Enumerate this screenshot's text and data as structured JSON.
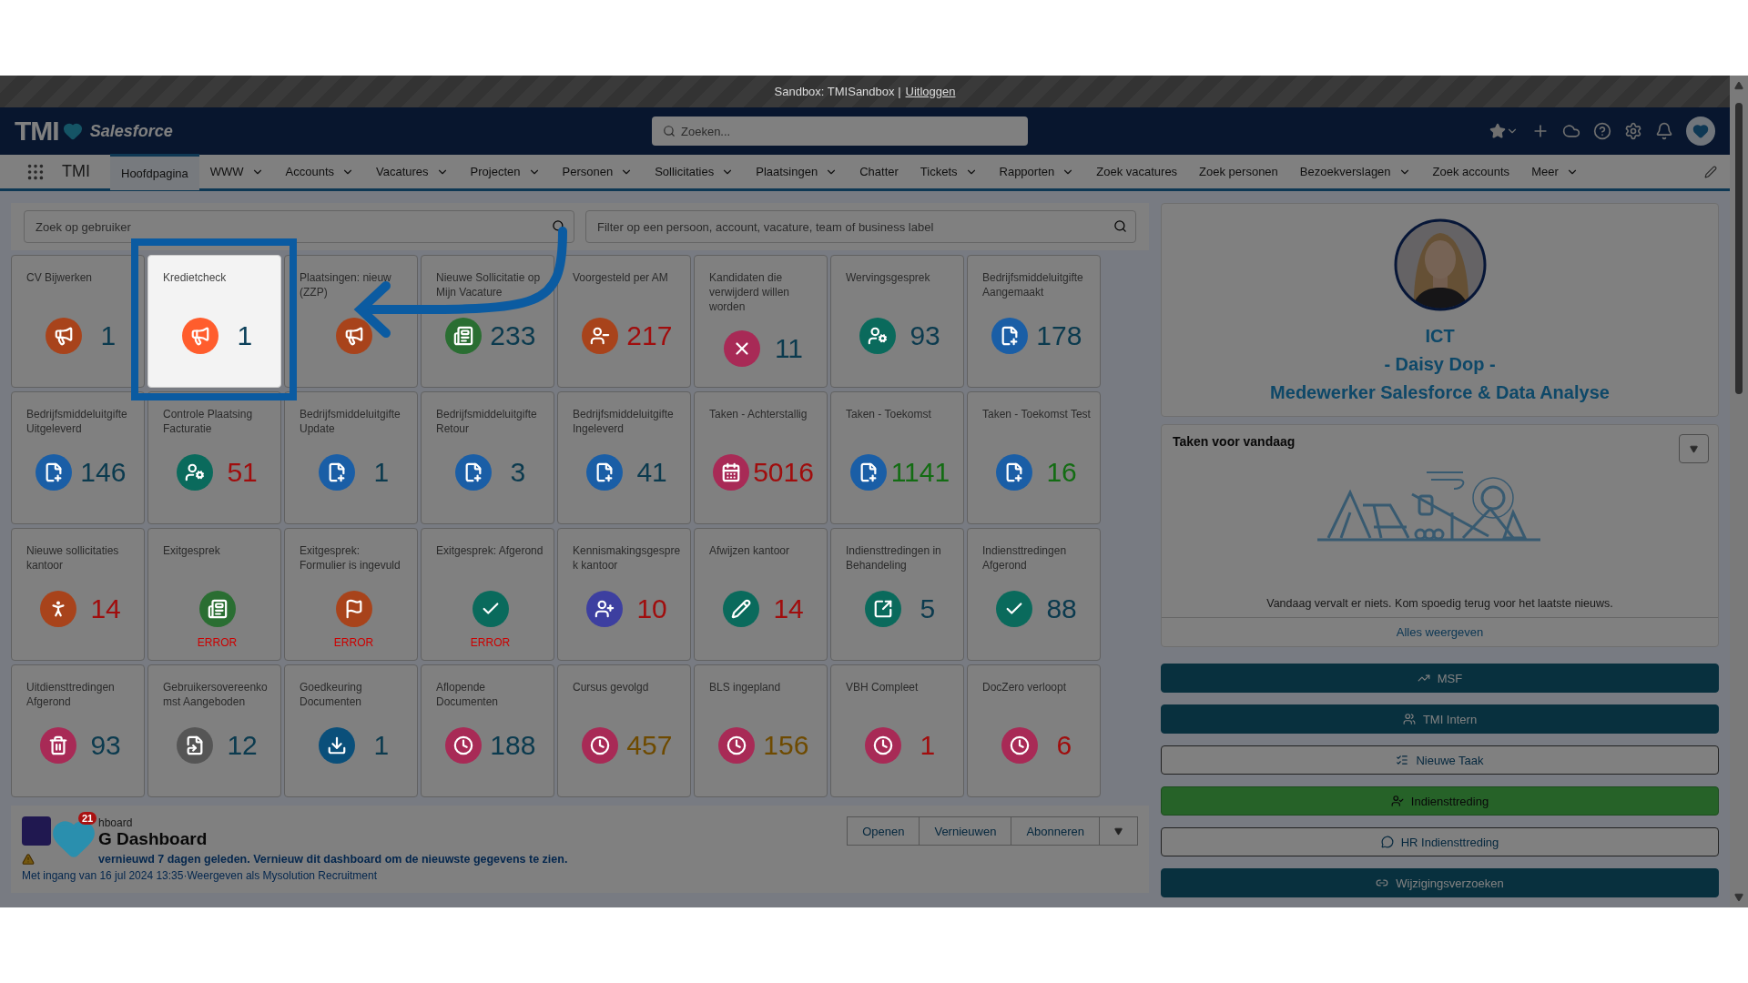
{
  "sandbox_bar": {
    "text": "Sandbox: TMISandbox |",
    "link": "Uitloggen"
  },
  "header": {
    "logo_text": "TMI",
    "brand": "Salesforce",
    "search": {
      "placeholder": "Zoeken..."
    }
  },
  "nav": {
    "app_name": "TMI",
    "items": [
      {
        "label": "Hoofdpagina",
        "selected": true,
        "dropdown": false
      },
      {
        "label": "WWW",
        "selected": false,
        "dropdown": true
      },
      {
        "label": "Accounts",
        "selected": false,
        "dropdown": true
      },
      {
        "label": "Vacatures",
        "selected": false,
        "dropdown": true
      },
      {
        "label": "Projecten",
        "selected": false,
        "dropdown": true
      },
      {
        "label": "Personen",
        "selected": false,
        "dropdown": true
      },
      {
        "label": "Sollicitaties",
        "selected": false,
        "dropdown": true
      },
      {
        "label": "Plaatsingen",
        "selected": false,
        "dropdown": true
      },
      {
        "label": "Chatter",
        "selected": false,
        "dropdown": false
      },
      {
        "label": "Tickets",
        "selected": false,
        "dropdown": true
      },
      {
        "label": "Rapporten",
        "selected": false,
        "dropdown": true
      },
      {
        "label": "Zoek vacatures",
        "selected": false,
        "dropdown": false
      },
      {
        "label": "Zoek personen",
        "selected": false,
        "dropdown": false
      },
      {
        "label": "Bezoekverslagen",
        "selected": false,
        "dropdown": true
      },
      {
        "label": "Zoek accounts",
        "selected": false,
        "dropdown": false
      },
      {
        "label": "Meer",
        "selected": false,
        "dropdown": true
      }
    ]
  },
  "filters": {
    "user_search": {
      "placeholder": "Zoek op gebruiker"
    },
    "filter": {
      "placeholder": "Filter op een persoon, account, vacature, team of business label"
    }
  },
  "tiles": [
    {
      "label": "CV Bijwerken",
      "kind": "megaphone",
      "color": "#a8431b",
      "value": {
        "text": "1",
        "color": "#0b3a4e"
      },
      "highlighted": false
    },
    {
      "label": "Kredietcheck",
      "kind": "megaphone",
      "color": "#ff5d2d",
      "value": {
        "text": "1",
        "color": "#0b3f59"
      },
      "highlighted": true
    },
    {
      "label": "Plaatsingen: nieuw (ZZP)",
      "kind": "megaphone",
      "color": "#a8431b",
      "highlighted": false
    },
    {
      "label": "Nieuwe Sollicitatie op Mijn Vacature",
      "kind": "news",
      "color": "#2a6e32",
      "value": {
        "text": "233",
        "color": "#0b3a4e"
      },
      "highlighted": false
    },
    {
      "label": "Voorgesteld per AM",
      "kind": "user-minus",
      "color": "#a8431b",
      "value": {
        "text": "217",
        "color": "#a00d0d"
      },
      "highlighted": false
    },
    {
      "label": "Kandidaten die verwijderd willen worden",
      "kind": "x",
      "color": "#a82a56",
      "value": {
        "text": "11",
        "color": "#0b3a4e"
      },
      "highlighted": false
    },
    {
      "label": "Wervingsgesprek",
      "kind": "user-edit",
      "color": "#0a6a5c",
      "value": {
        "text": "93",
        "color": "#0b3a4e"
      },
      "highlighted": false
    },
    {
      "label": "Bedrijfsmiddeluitgifte Aangemaakt",
      "kind": "file-plus",
      "color": "#1a5ea6",
      "value": {
        "text": "178",
        "color": "#0b3a4e"
      },
      "highlighted": false
    },
    {
      "label": "Bedrijfsmiddeluitgifte Uitgeleverd",
      "kind": "file-plus",
      "color": "#1a5ea6",
      "value": {
        "text": "146",
        "color": "#0b3a4e"
      },
      "highlighted": false
    },
    {
      "label": "Controle Plaatsing Facturatie",
      "kind": "user-edit",
      "color": "#0a6a5c",
      "value": {
        "text": "51",
        "color": "#a00d0d"
      },
      "highlighted": false
    },
    {
      "label": "Bedrijfsmiddeluitgifte Update",
      "kind": "file-plus",
      "color": "#1a5ea6",
      "value": {
        "text": "1",
        "color": "#0b3a4e"
      },
      "highlighted": false
    },
    {
      "label": "Bedrijfsmiddeluitgifte Retour",
      "kind": "file-plus",
      "color": "#1a5ea6",
      "value": {
        "text": "3",
        "color": "#0b3a4e"
      },
      "highlighted": false
    },
    {
      "label": "Bedrijfsmiddeluitgifte Ingeleverd",
      "kind": "file-plus",
      "color": "#1a5ea6",
      "value": {
        "text": "41",
        "color": "#0b3a4e"
      },
      "highlighted": false
    },
    {
      "label": "Taken - Achterstallig",
      "kind": "calendar",
      "color": "#a82a56",
      "value": {
        "text": "5016",
        "color": "#a00d0d"
      },
      "highlighted": false
    },
    {
      "label": "Taken - Toekomst",
      "kind": "file-plus",
      "color": "#1a5ea6",
      "value": {
        "text": "1141",
        "color": "#136c13"
      },
      "highlighted": false
    },
    {
      "label": "Taken - Toekomst Test",
      "kind": "file-plus",
      "color": "#1a5ea6",
      "value": {
        "text": "16",
        "color": "#136c13"
      },
      "highlighted": false
    },
    {
      "label": "Nieuwe sollicitaties kantoor",
      "kind": "person",
      "color": "#a8431b",
      "value": {
        "text": "14",
        "color": "#a00d0d"
      },
      "highlighted": false
    },
    {
      "label": "Exitgesprek",
      "kind": "news",
      "color": "#2a6e32",
      "error": "ERROR",
      "highlighted": false
    },
    {
      "label": "Exitgesprek: Formulier is ingevuld",
      "kind": "flag",
      "color": "#a8431b",
      "error": "ERROR",
      "highlighted": false
    },
    {
      "label": "Exitgesprek: Afgerond",
      "kind": "check",
      "color": "#0a6a5c",
      "error": "ERROR",
      "highlighted": false
    },
    {
      "label": "Kennismakingsgesprek kantoor",
      "kind": "user-plus",
      "color": "#3d3fa0",
      "value": {
        "text": "10",
        "color": "#a00d0d"
      },
      "highlighted": false
    },
    {
      "label": "Afwijzen kantoor",
      "kind": "pencil",
      "color": "#0a6a5c",
      "value": {
        "text": "14",
        "color": "#a00d0d"
      },
      "highlighted": false
    },
    {
      "label": "Indiensttredingen in Behandeling",
      "kind": "open",
      "color": "#0a6a5c",
      "value": {
        "text": "5",
        "color": "#0b3a4e"
      },
      "highlighted": false
    },
    {
      "label": "Indiensttredingen Afgerond",
      "kind": "check",
      "color": "#0a6a5c",
      "value": {
        "text": "88",
        "color": "#0b3a4e"
      },
      "highlighted": false
    },
    {
      "label": "Uitdiensttredingen Afgerond",
      "kind": "trash",
      "color": "#a82a56",
      "value": {
        "text": "93",
        "color": "#0b3a4e"
      },
      "highlighted": false
    },
    {
      "label": "Gebruikersovereenkomst Aangeboden",
      "kind": "doc",
      "color": "#555555",
      "value": {
        "text": "12",
        "color": "#0b3a4e"
      },
      "highlighted": false
    },
    {
      "label": "Goedkeuring Documenten",
      "kind": "download",
      "color": "#0a4f7a",
      "value": {
        "text": "1",
        "color": "#0b3a4e"
      },
      "highlighted": false
    },
    {
      "label": "Aflopende Documenten",
      "kind": "clock",
      "color": "#a82a56",
      "value": {
        "text": "188",
        "color": "#0b3a4e"
      },
      "highlighted": false
    },
    {
      "label": "Cursus gevolgd",
      "kind": "clock",
      "color": "#a82a56",
      "value": {
        "text": "457",
        "color": "#6e4a00"
      },
      "highlighted": false
    },
    {
      "label": "BLS ingepland",
      "kind": "clock",
      "color": "#a82a56",
      "value": {
        "text": "156",
        "color": "#6e4a00"
      },
      "highlighted": false
    },
    {
      "label": "VBH Compleet",
      "kind": "clock",
      "color": "#a82a56",
      "value": {
        "text": "1",
        "color": "#a00d0d"
      },
      "highlighted": false
    },
    {
      "label": "DocZero verloopt",
      "kind": "clock",
      "color": "#a82a56",
      "value": {
        "text": "6",
        "color": "#a00d0d"
      },
      "highlighted": false
    }
  ],
  "dashboard": {
    "eyebrow": "hboard",
    "title": "G Dashboard",
    "warning": "vernieuwd 7 dagen geleden. Vernieuw dit dashboard om de nieuwste gegevens te zien.",
    "meta": "Met ingang van 16 jul 2024 13:35·Weergeven als Mysolution Recruitment",
    "buttons": [
      "Openen",
      "Vernieuwen",
      "Abonneren"
    ]
  },
  "helper_badge": {
    "count": "21"
  },
  "profile": {
    "lines": [
      "ICT",
      "- Daisy Dop -",
      "Medewerker Salesforce & Data Analyse"
    ]
  },
  "tasks": {
    "title": "Taken voor vandaag",
    "empty_text": "Vandaag vervalt er niets. Kom spoedig terug voor het laatste nieuws.",
    "link": "Alles weergeven"
  },
  "actions": [
    {
      "label": "MSF",
      "kind": "dark"
    },
    {
      "label": "TMI Intern",
      "kind": "dark"
    },
    {
      "label": "Nieuwe Taak",
      "kind": "outline"
    },
    {
      "label": "Indiensttreding",
      "kind": "green"
    },
    {
      "label": "HR Indiensttreding",
      "kind": "outline"
    },
    {
      "label": "Wijzigingsverzoeken",
      "kind": "dark"
    }
  ]
}
